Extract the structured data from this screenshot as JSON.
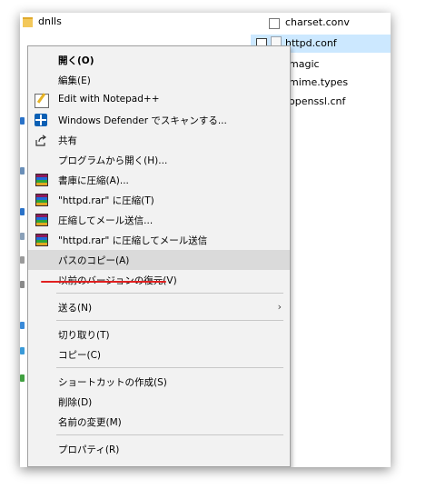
{
  "background_files": {
    "folder_label": "dnlls",
    "files": [
      "charset.conv",
      "httpd.conf",
      "magic",
      "mime.types",
      "openssl.cnf"
    ]
  },
  "context_menu": {
    "items": [
      {
        "label": "開く(O)",
        "icon": "none",
        "bold": true
      },
      {
        "label": "編集(E)",
        "icon": "none"
      },
      {
        "label": "Edit with Notepad++",
        "icon": "notepad-plus-plus-icon"
      },
      {
        "label": "Windows Defender でスキャンする...",
        "icon": "windows-defender-icon"
      },
      {
        "label": "共有",
        "icon": "share-icon"
      },
      {
        "label": "プログラムから開く(H)...",
        "icon": "none"
      },
      {
        "label": "書庫に圧縮(A)...",
        "icon": "winrar-icon"
      },
      {
        "label": "\"httpd.rar\" に圧縮(T)",
        "icon": "winrar-icon"
      },
      {
        "label": "圧縮してメール送信...",
        "icon": "winrar-icon"
      },
      {
        "label": "\"httpd.rar\" に圧縮してメール送信",
        "icon": "winrar-icon"
      },
      {
        "label": "パスのコピー(A)",
        "icon": "none",
        "highlighted": true
      },
      {
        "label": "以前のバージョンの復元(V)",
        "icon": "none"
      },
      {
        "label": "送る(N)",
        "icon": "none",
        "submenu": true
      },
      {
        "label": "切り取り(T)",
        "icon": "none"
      },
      {
        "label": "コピー(C)",
        "icon": "none"
      },
      {
        "label": "ショートカットの作成(S)",
        "icon": "none"
      },
      {
        "label": "削除(D)",
        "icon": "none"
      },
      {
        "label": "名前の変更(M)",
        "icon": "none"
      },
      {
        "label": "プロパティ(R)",
        "icon": "none"
      }
    ],
    "submenu_arrow": "›",
    "highlight_color": "#dadada",
    "annotation_color": "#e02020"
  }
}
